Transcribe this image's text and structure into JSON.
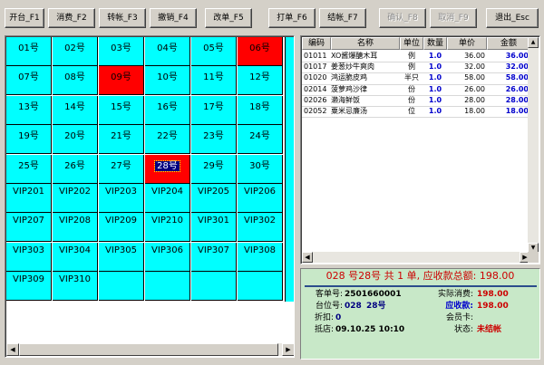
{
  "toolbar": {
    "buttons": [
      {
        "label": "开台_F1",
        "enabled": true
      },
      {
        "label": "消费_F2",
        "enabled": true
      },
      {
        "label": "转帐_F3",
        "enabled": true
      },
      {
        "label": "撤销_F4",
        "enabled": true
      },
      {
        "label": "改单_F5",
        "enabled": true
      },
      {
        "label": "打单_F6",
        "enabled": true
      },
      {
        "label": "结帐_F7",
        "enabled": true
      },
      {
        "label": "确认_F8",
        "enabled": false
      },
      {
        "label": "取消_F9",
        "enabled": false
      },
      {
        "label": "退出_Esc",
        "enabled": true
      }
    ]
  },
  "tables": {
    "rows": [
      [
        "01号",
        "02号",
        "03号",
        "04号",
        "05号",
        "06号"
      ],
      [
        "07号",
        "08号",
        "09号",
        "10号",
        "11号",
        "12号"
      ],
      [
        "13号",
        "14号",
        "15号",
        "16号",
        "17号",
        "18号"
      ],
      [
        "19号",
        "20号",
        "21号",
        "22号",
        "23号",
        "24号"
      ],
      [
        "25号",
        "26号",
        "27号",
        "28号",
        "29号",
        "30号"
      ],
      [
        "VIP201",
        "VIP202",
        "VIP203",
        "VIP204",
        "VIP205",
        "VIP206"
      ],
      [
        "VIP207",
        "VIP208",
        "VIP209",
        "VIP210",
        "VIP301",
        "VIP302"
      ],
      [
        "VIP303",
        "VIP304",
        "VIP305",
        "VIP306",
        "VIP307",
        "VIP308"
      ],
      [
        "VIP309",
        "VIP310",
        "",
        "",
        "",
        ""
      ]
    ],
    "occupied": [
      "06号",
      "09号",
      "28号"
    ],
    "selected": "28号",
    "free_color": "#00ffff",
    "occupied_color": "#ff0000"
  },
  "order": {
    "headers": [
      "编码",
      "名称",
      "单位",
      "数量",
      "单价",
      "金额"
    ],
    "items": [
      {
        "code": "01011",
        "name": "XO酱爆醣木耳",
        "unit": "例",
        "qty": "1.0",
        "price": "36.00",
        "amount": "36.00"
      },
      {
        "code": "01017",
        "name": "姜葱炒牛爽肉",
        "unit": "例",
        "qty": "1.0",
        "price": "32.00",
        "amount": "32.00"
      },
      {
        "code": "01020",
        "name": "鸿运脆皮鸡",
        "unit": "半只",
        "qty": "1.0",
        "price": "58.00",
        "amount": "58.00"
      },
      {
        "code": "02014",
        "name": "菠萝鸡沙律",
        "unit": "份",
        "qty": "1.0",
        "price": "26.00",
        "amount": "26.00"
      },
      {
        "code": "02026",
        "name": "濑海鲜饭",
        "unit": "份",
        "qty": "1.0",
        "price": "28.00",
        "amount": "28.00"
      },
      {
        "code": "02052",
        "name": "粟米忌廉汤",
        "unit": "位",
        "qty": "1.0",
        "price": "18.00",
        "amount": "18.00"
      }
    ]
  },
  "summary": {
    "title": "028 号28号 共 1 单, 应收款总额: 198.00",
    "order_no_label": "客单号:",
    "order_no": "2501660001",
    "table_label": "台位号:",
    "table_code": "028",
    "table_name": "28号",
    "discount_label": "折扣:",
    "discount": "0",
    "arrival_label": "抵店:",
    "arrival": "09.10.25 10:10",
    "actual_label": "实际消费:",
    "actual": "198.00",
    "receivable_label": "应收款:",
    "receivable": "198.00",
    "member_label": "会员卡:",
    "member": "",
    "status_label": "状态:",
    "status": "未结帐"
  }
}
